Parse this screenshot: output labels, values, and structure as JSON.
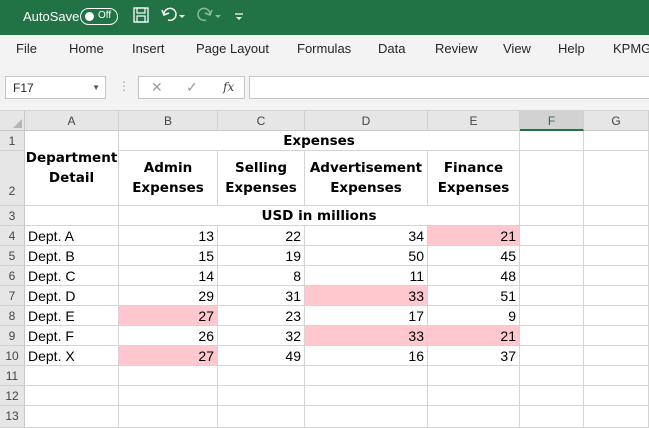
{
  "titlebar": {
    "autosave_label": "AutoSave",
    "autosave_state": "Off"
  },
  "menu": [
    "File",
    "Home",
    "Insert",
    "Page Layout",
    "Formulas",
    "Data",
    "Review",
    "View",
    "Help",
    "KPMG"
  ],
  "formula_bar": {
    "name_box": "F17",
    "fx_label": "fx",
    "formula": ""
  },
  "columns": [
    "A",
    "B",
    "C",
    "D",
    "E",
    "F",
    "G"
  ],
  "selected_column": "F",
  "rows": [
    "1",
    "2",
    "3",
    "4",
    "5",
    "6",
    "7",
    "8",
    "9",
    "10",
    "11",
    "12",
    "13"
  ],
  "sheet": {
    "header_expenses": "Expenses",
    "department_detail": "Department Detail",
    "admin": "Admin Expenses",
    "selling": "Selling Expenses",
    "advertisement": "Advertisement Expenses",
    "finance": "Finance Expenses",
    "units": "USD in millions",
    "data": [
      {
        "dept": "Dept. A",
        "admin": "13",
        "selling": "22",
        "adv": "34",
        "fin": "21"
      },
      {
        "dept": "Dept. B",
        "admin": "15",
        "selling": "19",
        "adv": "50",
        "fin": "45"
      },
      {
        "dept": "Dept. C",
        "admin": "14",
        "selling": "8",
        "adv": "11",
        "fin": "48"
      },
      {
        "dept": "Dept. D",
        "admin": "29",
        "selling": "31",
        "adv": "33",
        "fin": "51"
      },
      {
        "dept": "Dept. E",
        "admin": "27",
        "selling": "23",
        "adv": "17",
        "fin": "9"
      },
      {
        "dept": "Dept. F",
        "admin": "26",
        "selling": "32",
        "adv": "33",
        "fin": "21"
      },
      {
        "dept": "Dept. X",
        "admin": "27",
        "selling": "49",
        "adv": "16",
        "fin": "37"
      }
    ]
  },
  "colors": {
    "excel_green": "#217346",
    "highlight_pink": "#ffc7ce"
  }
}
